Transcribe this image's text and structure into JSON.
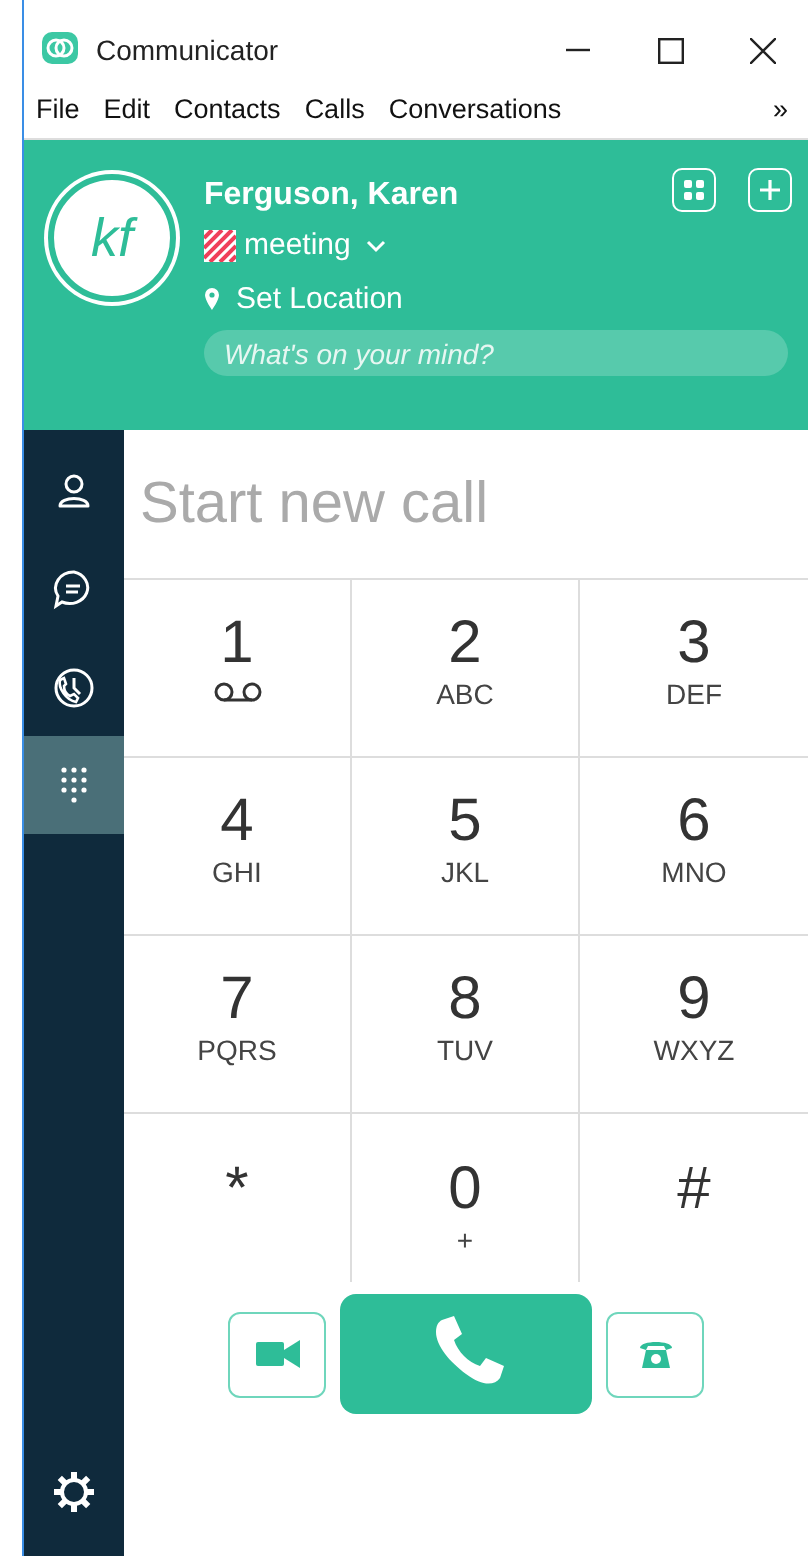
{
  "window": {
    "title": "Communicator"
  },
  "menu": [
    "File",
    "Edit",
    "Contacts",
    "Calls",
    "Conversations"
  ],
  "menu_overflow": "»",
  "profile": {
    "initials": "kf",
    "name": "Ferguson, Karen",
    "status": "meeting",
    "location": "Set Location",
    "mood_placeholder": "What's on your mind?"
  },
  "nav": [
    {
      "kind": "contacts",
      "selected": false
    },
    {
      "kind": "chat",
      "selected": false
    },
    {
      "kind": "history",
      "selected": false
    },
    {
      "kind": "dialpad",
      "selected": true
    }
  ],
  "search": {
    "placeholder": "Start new call"
  },
  "keys": [
    {
      "digit": "1",
      "kind": "voicemail"
    },
    {
      "digit": "2",
      "kind": "letters",
      "sub": "ABC"
    },
    {
      "digit": "3",
      "kind": "letters",
      "sub": "DEF"
    },
    {
      "digit": "4",
      "kind": "letters",
      "sub": "GHI"
    },
    {
      "digit": "5",
      "kind": "letters",
      "sub": "JKL"
    },
    {
      "digit": "6",
      "kind": "letters",
      "sub": "MNO"
    },
    {
      "digit": "7",
      "kind": "letters",
      "sub": "PQRS"
    },
    {
      "digit": "8",
      "kind": "letters",
      "sub": "TUV"
    },
    {
      "digit": "9",
      "kind": "letters",
      "sub": "WXYZ"
    },
    {
      "digit": "*",
      "kind": "plain"
    },
    {
      "digit": "0",
      "kind": "letters",
      "sub": "+"
    },
    {
      "digit": "#",
      "kind": "plain"
    }
  ]
}
